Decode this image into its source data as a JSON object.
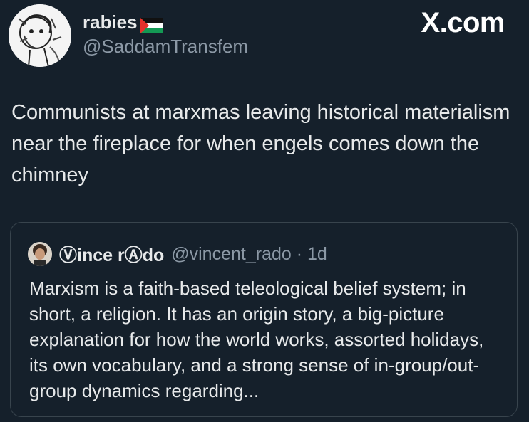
{
  "author": {
    "display_name": "rabies",
    "handle": "@SaddamTransfem",
    "flag_icon": "palestine-flag-icon"
  },
  "brand": "X.com",
  "tweet": {
    "text": "Communists at marxmas leaving historical materialism near the fireplace for when engels comes down the chimney"
  },
  "quote": {
    "display_name": "Ⓥince rⒶdo",
    "handle_and_time": "@vincent_rado · 1d",
    "text": "Marxism is a faith-based teleological belief system; in short, a religion. It has an origin story, a big-picture explanation for how the world works, assorted holidays, its own vocabulary, and a strong sense of in-group/out-group dynamics regarding..."
  },
  "colors": {
    "background": "#15202b",
    "text_primary": "#e7e9ea",
    "text_secondary": "#8b98a5",
    "border": "#38444d"
  }
}
